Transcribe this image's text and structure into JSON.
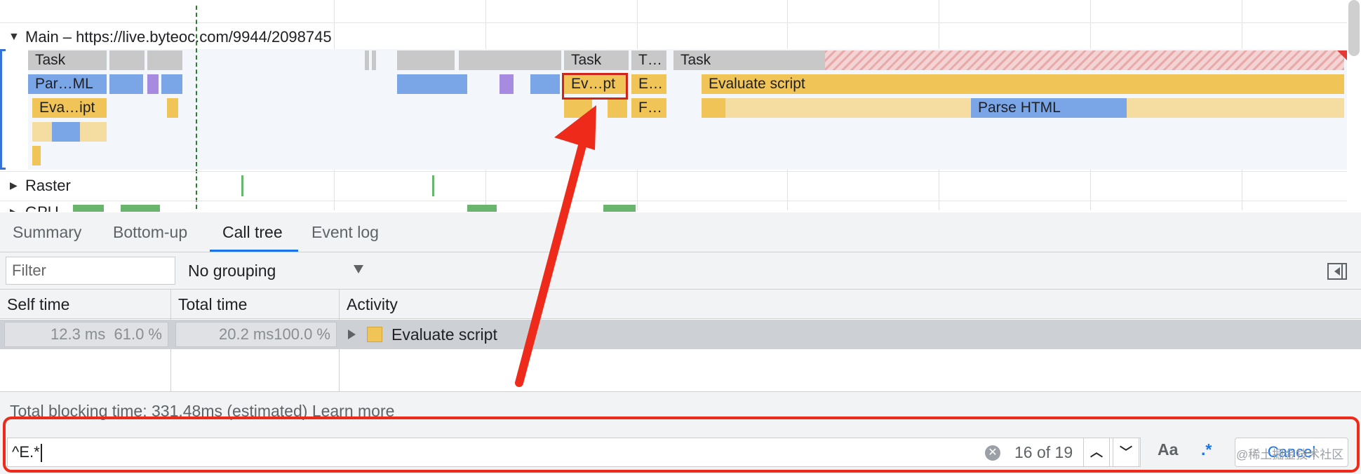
{
  "flame": {
    "main_title": "Main – https://live.byteoc.com/9944/2098745",
    "raster_title": "Raster",
    "gpu_title": "GPU",
    "blocks": {
      "task1": "Task",
      "task2": "Task",
      "task3": "T…",
      "task4": "Task",
      "parse_ml": "Par…ML",
      "eval_ipt": "Eva…ipt",
      "ev_pt": "Ev…pt",
      "e_ell": "E…",
      "f_ell": "F…",
      "evaluate_script": "Evaluate script",
      "parse_html": "Parse HTML"
    }
  },
  "tabs": [
    "Summary",
    "Bottom-up",
    "Call tree",
    "Event log"
  ],
  "active_tab": "Call tree",
  "toolbar": {
    "filter_placeholder": "Filter",
    "grouping": "No grouping"
  },
  "table": {
    "headers": [
      "Self time",
      "Total time",
      "Activity"
    ],
    "rows": [
      {
        "self_time": "12.3 ms",
        "self_pct": "61.0 %",
        "total_time": "20.2 ms",
        "total_pct": "100.0 %",
        "activity": "Evaluate script",
        "activity_color": "#f0c457"
      }
    ]
  },
  "footer": {
    "tbt_text": "Total blocking time: 331.48ms (estimated)",
    "learn_more": "Learn more"
  },
  "search": {
    "query": "^E.*",
    "match_count": "16 of 19",
    "case_label": "Aa",
    "regex_label": ".*",
    "cancel_label": "Cancel",
    "watermark": "@稀土掘金技术社区"
  },
  "colors": {
    "annotation_red": "#ee2a1a",
    "accent_blue": "#1a73e8",
    "task_yellow": "#f0c457",
    "parse_blue": "#7aa5e6"
  }
}
